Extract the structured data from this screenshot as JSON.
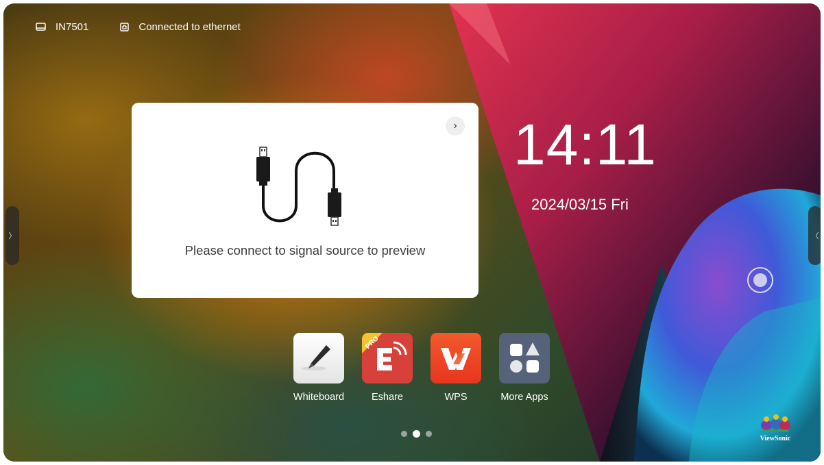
{
  "status_bar": {
    "device_name": "IN7501",
    "device_icon": "display-icon",
    "network_status": "Connected to ethernet",
    "network_icon": "ethernet-icon"
  },
  "preview_card": {
    "message": "Please connect to signal source to preview",
    "arrow": "›"
  },
  "clock": {
    "time": "14:11",
    "date": "2024/03/15 Fri"
  },
  "side_tabs": {
    "left_glyph": "〉",
    "right_glyph": "〈"
  },
  "apps": [
    {
      "label": "Whiteboard",
      "icon": "whiteboard-icon"
    },
    {
      "label": "Eshare",
      "icon": "eshare-icon",
      "badge": "PRO"
    },
    {
      "label": "WPS",
      "icon": "wps-icon"
    },
    {
      "label": "More Apps",
      "icon": "more-apps-icon"
    }
  ],
  "pager": {
    "count": 3,
    "active": 2
  },
  "brand": {
    "logo_text": "ViewSonic"
  }
}
